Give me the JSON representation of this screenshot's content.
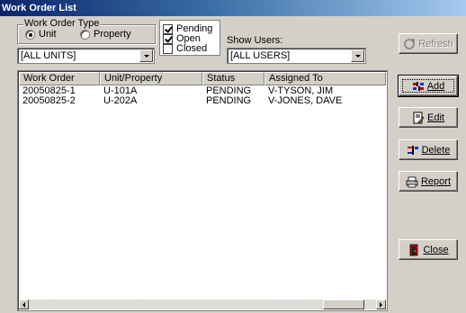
{
  "window": {
    "title": "Work Order List"
  },
  "type_group": {
    "title": "Work Order Type",
    "options": [
      {
        "label": "Unit",
        "selected": true
      },
      {
        "label": "Property",
        "selected": false
      }
    ]
  },
  "unit_filter": {
    "value": "[ALL UNITS]"
  },
  "status_filter": {
    "items": [
      {
        "label": "Pending",
        "checked": true
      },
      {
        "label": "Open",
        "checked": true
      },
      {
        "label": "Closed",
        "checked": false
      }
    ]
  },
  "users_filter": {
    "label": "Show Users:",
    "value": "[ALL USERS]"
  },
  "table": {
    "columns": [
      "Work Order",
      "Unit/Property",
      "Status",
      "Assigned To"
    ],
    "rows": [
      [
        "20050825-1",
        "U-101A",
        "PENDING",
        "V-TYSON, JIM"
      ],
      [
        "20050825-2",
        "U-202A",
        "PENDING",
        "V-JONES, DAVE"
      ]
    ]
  },
  "buttons": {
    "refresh": "Refresh",
    "add": "Add",
    "edit": "Edit",
    "delete": "Delete",
    "report": "Report",
    "close": "Close"
  },
  "colors": {
    "face": "#d4d0c8",
    "title_start": "#0a246a",
    "title_end": "#a6caf0"
  },
  "icons": [
    "refresh-icon",
    "add-icon",
    "edit-icon",
    "delete-icon",
    "report-icon",
    "close-icon"
  ]
}
